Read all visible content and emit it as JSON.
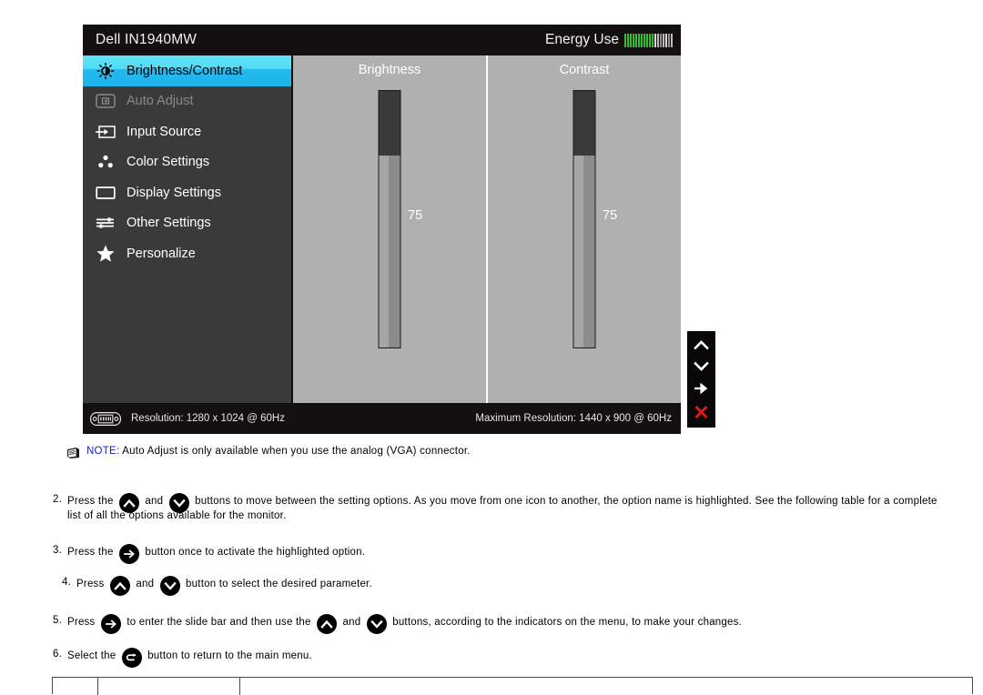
{
  "osd": {
    "title": "Dell IN1940MW",
    "energy": {
      "label": "Energy Use",
      "bars": [
        "on",
        "on",
        "on",
        "on",
        "on",
        "on",
        "on",
        "on",
        "on",
        "on",
        "on",
        "light",
        "dim",
        "gray",
        "dim",
        "light",
        "gray",
        "dim"
      ]
    },
    "menu": [
      {
        "label": "Brightness/Contrast",
        "icon": "brightness-icon",
        "state": "selected"
      },
      {
        "label": "Auto Adjust",
        "icon": "auto-adjust-icon",
        "state": "disabled"
      },
      {
        "label": "Input Source",
        "icon": "input-source-icon",
        "state": "normal"
      },
      {
        "label": "Color Settings",
        "icon": "color-settings-icon",
        "state": "normal"
      },
      {
        "label": "Display Settings",
        "icon": "display-settings-icon",
        "state": "normal"
      },
      {
        "label": "Other Settings",
        "icon": "other-settings-icon",
        "state": "normal"
      },
      {
        "label": "Personalize",
        "icon": "star-icon",
        "state": "normal"
      }
    ],
    "sliders": [
      {
        "title": "Brightness",
        "value": "75",
        "percent": 75
      },
      {
        "title": "Contrast",
        "value": "75",
        "percent": 75
      }
    ],
    "status": {
      "resolution": "Resolution: 1280 x 1024 @ 60Hz",
      "max_resolution": "Maximum Resolution: 1440 x 900 @ 60Hz",
      "connector_icon": "vga-connector-icon"
    },
    "arrows": [
      {
        "icon": "chevron-up-icon",
        "color": "#ffffff"
      },
      {
        "icon": "chevron-down-icon",
        "color": "#ffffff"
      },
      {
        "icon": "arrow-right-icon",
        "color": "#ffffff"
      },
      {
        "icon": "close-x-icon",
        "color": "#e01b1b"
      }
    ],
    "colors": {
      "highlight_top": "#5fe2f7",
      "highlight_bottom": "#1fb3ec",
      "sidebar_bg": "#3a3a3a",
      "panel_bg": "#b0b0b0",
      "bar_bg": "#141011",
      "energy_green": "#2fc22f",
      "close_red": "#e01b1b"
    }
  },
  "note": {
    "label": "NOTE:",
    "text": "Auto Adjust is only available when you use the analog (VGA) connector.",
    "icon": "note-icon"
  },
  "steps": [
    {
      "num": "2.",
      "text_a": "Press the",
      "text_b": "and",
      "text_c": "buttons to move between the setting options. As you move from one icon to another, the option name is highlighted. See the following table for a complete",
      "text_d": "list of all the options available for the monitor."
    },
    {
      "num": "3.",
      "text_a": "Press the",
      "text_b": "button once to activate the highlighted option."
    },
    {
      "num": "4.",
      "text_a": "Press",
      "text_b": "and",
      "text_c": "button to select the desired parameter."
    },
    {
      "num": "5.",
      "text_a": "Press",
      "text_b": "to enter the slide bar and then use the",
      "text_c": "and",
      "text_d": "buttons, according to the indicators on the menu, to make your changes."
    },
    {
      "num": "6.",
      "text_a": "Select the",
      "text_b": "button to return to the main menu."
    }
  ]
}
